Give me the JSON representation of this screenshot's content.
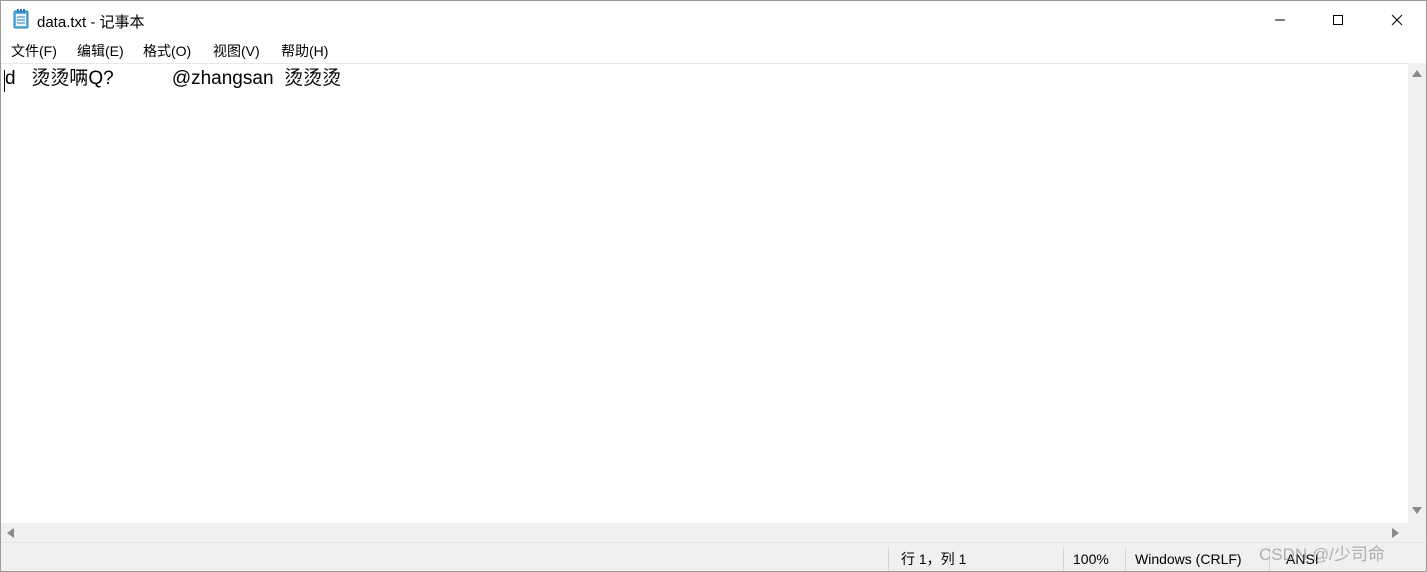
{
  "window": {
    "title": "data.txt - 记事本",
    "app_icon": "notepad-icon",
    "controls": {
      "minimize": "minimize-icon",
      "maximize": "maximize-icon",
      "close": "close-icon"
    }
  },
  "menubar": {
    "items": [
      {
        "label": "文件(F)"
      },
      {
        "label": "编辑(E)"
      },
      {
        "label": "格式(O)"
      },
      {
        "label": "视图(V)"
      },
      {
        "label": "帮助(H)"
      }
    ]
  },
  "editor": {
    "content": "d   烫烫唡Q?           @zhangsan  烫烫烫"
  },
  "statusbar": {
    "position": "行 1，列 1",
    "zoom": "100%",
    "line_ending": "Windows (CRLF)",
    "encoding": "ANSI"
  },
  "watermark": {
    "text": "CSDN @/少司命"
  }
}
